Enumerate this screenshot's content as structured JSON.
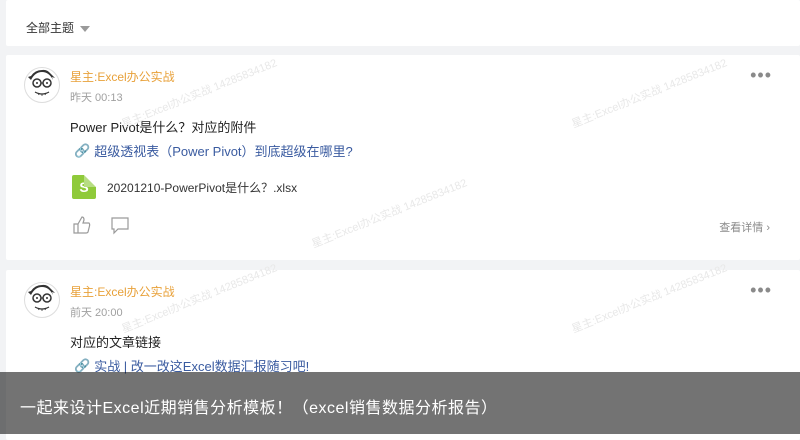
{
  "filter": {
    "label": "全部主题"
  },
  "posts": [
    {
      "author": "星主:Excel办公实战",
      "time": "昨天 00:13",
      "content": "Power Pivot是什么？对应的附件",
      "link": "超级透视表（Power Pivot）到底超级在哪里?",
      "file": {
        "icon_letter": "S",
        "name": "20201210-PowerPivot是什么？.xlsx"
      },
      "detail": "查看详情 ›"
    },
    {
      "author": "星主:Excel办公实战",
      "time": "前天 20:00",
      "content": "对应的文章链接",
      "link": "实战 | 改一改这Excel数据汇报随习吧!"
    }
  ],
  "more_label": "•••",
  "watermark": "星主:Excel办公实战 14285834182",
  "banner": {
    "text": "一起来设计Excel近期销售分析模板！（excel销售数据分析报告）"
  },
  "icons": {
    "like": "thumbs-up-icon",
    "comment": "comment-icon",
    "link": "link-icon",
    "file": "spreadsheet-file-icon",
    "caret": "caret-down-icon"
  }
}
